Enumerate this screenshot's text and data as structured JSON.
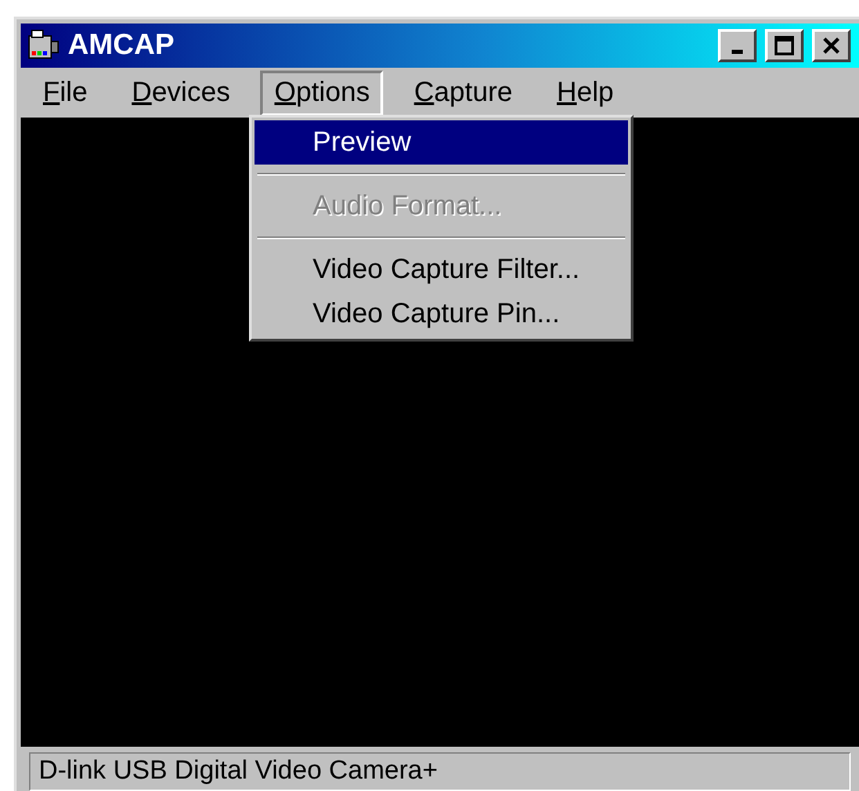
{
  "window": {
    "title": "AMCAP"
  },
  "menu_bar": [
    {
      "key": "F",
      "rest": "ile",
      "selected": false
    },
    {
      "key": "D",
      "rest": "evices",
      "selected": false
    },
    {
      "key": "O",
      "rest": "ptions",
      "selected": true
    },
    {
      "key": "C",
      "rest": "apture",
      "selected": false
    },
    {
      "key": "H",
      "rest": "elp",
      "selected": false
    }
  ],
  "dropdown": [
    {
      "kind": "item",
      "label": "Preview",
      "selected": true,
      "disabled": false
    },
    {
      "kind": "separator"
    },
    {
      "kind": "item",
      "label": "Audio Format...",
      "selected": false,
      "disabled": true
    },
    {
      "kind": "separator"
    },
    {
      "kind": "item",
      "label": "Video Capture Filter...",
      "selected": false,
      "disabled": false
    },
    {
      "kind": "item",
      "label": "Video Capture Pin...",
      "selected": false,
      "disabled": false
    }
  ],
  "status_bar": "D-link USB Digital Video Camera+"
}
